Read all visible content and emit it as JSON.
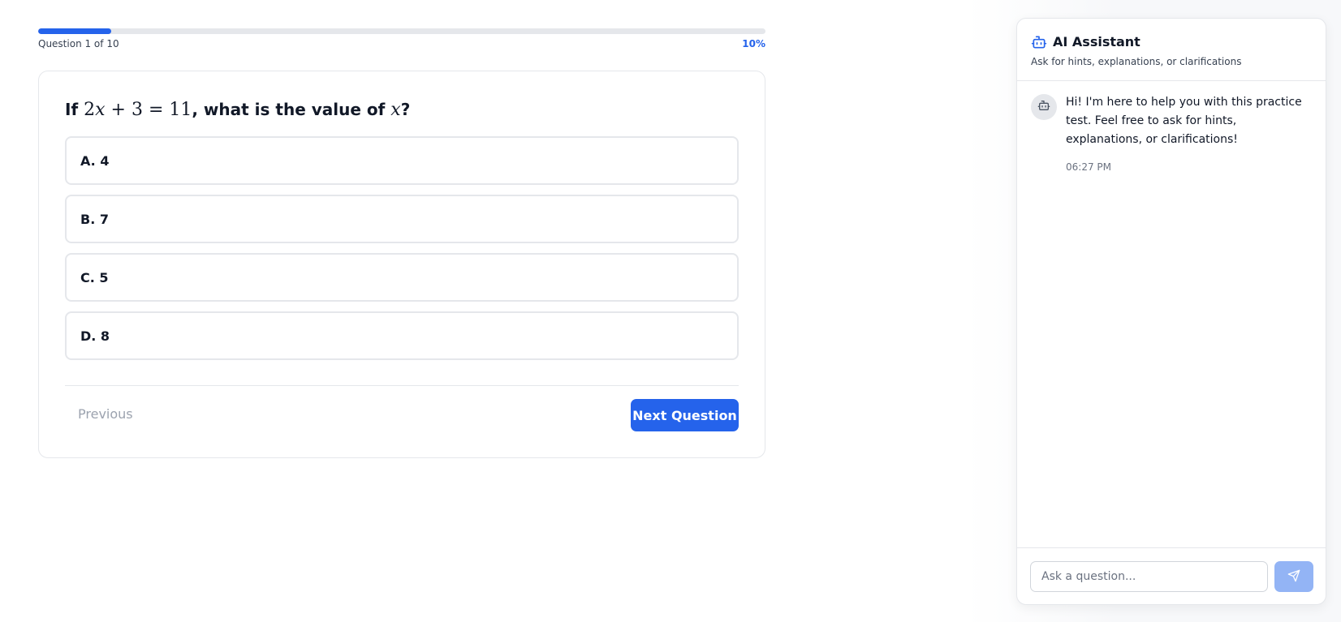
{
  "progress": {
    "label": "Question 1 of 10",
    "percent_label": "10%",
    "fraction": 0.1
  },
  "question": {
    "prefix": "If ",
    "math_parts": [
      "2",
      "x",
      " + 3 = 11"
    ],
    "middle": ", what is the value of ",
    "math_var": "x",
    "suffix": "?"
  },
  "options": [
    {
      "label": "A. 4"
    },
    {
      "label": "B. 7"
    },
    {
      "label": "C. 5"
    },
    {
      "label": "D. 8"
    }
  ],
  "navigation": {
    "previous_label": "Previous",
    "next_label": "Next Question"
  },
  "assistant": {
    "title": "AI Assistant",
    "subtitle": "Ask for hints, explanations, or clarifications",
    "message": {
      "text": "Hi! I'm here to help you with this practice test. Feel free to ask for hints, explanations, or clarifications!",
      "time": "06:27 PM"
    },
    "input_placeholder": "Ask a question...",
    "icons": {
      "header": "robot-icon",
      "avatar": "robot-icon",
      "send": "send-icon"
    }
  },
  "colors": {
    "primary": "#2563eb",
    "send_disabled": "#93b4f5",
    "border": "#e5e7eb"
  }
}
